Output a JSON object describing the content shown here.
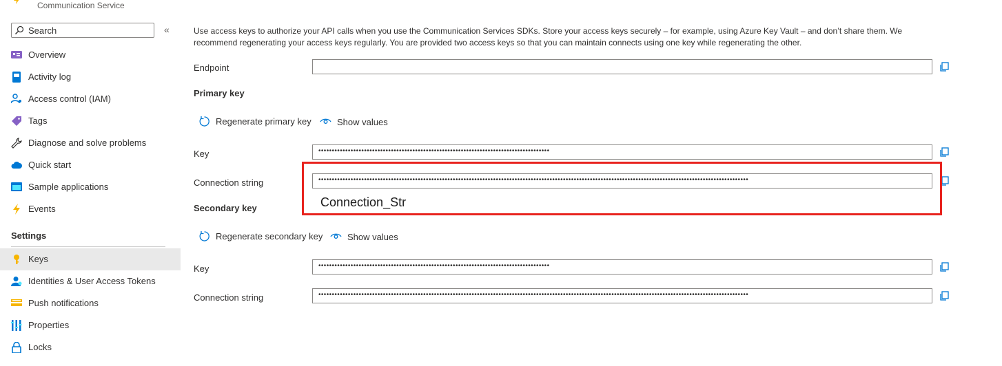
{
  "header": {
    "subtitle": "Communication Service"
  },
  "search": {
    "placeholder": "Search"
  },
  "sidebar": {
    "items": [
      {
        "label": "Overview",
        "icon": "overview-icon"
      },
      {
        "label": "Activity log",
        "icon": "activity-log-icon"
      },
      {
        "label": "Access control (IAM)",
        "icon": "iam-icon"
      },
      {
        "label": "Tags",
        "icon": "tag-icon"
      },
      {
        "label": "Diagnose and solve problems",
        "icon": "wrench-icon"
      },
      {
        "label": "Quick start",
        "icon": "cloud-icon"
      },
      {
        "label": "Sample applications",
        "icon": "sample-apps-icon"
      },
      {
        "label": "Events",
        "icon": "lightning-icon"
      }
    ],
    "settings_title": "Settings",
    "settings_items": [
      {
        "label": "Keys",
        "icon": "key-icon",
        "active": true
      },
      {
        "label": "Identities & User Access Tokens",
        "icon": "identity-icon"
      },
      {
        "label": "Push notifications",
        "icon": "push-notification-icon"
      },
      {
        "label": "Properties",
        "icon": "properties-icon"
      },
      {
        "label": "Locks",
        "icon": "lock-icon"
      }
    ]
  },
  "main": {
    "intro": "Use access keys to authorize your API calls when you use the Communication Services SDKs. Store your access keys securely – for example, using Azure Key Vault – and don’t share them. We recommend regenerating your access keys regularly. You are provided two access keys so that you can maintain connects using one key while regenerating the other.",
    "endpoint_label": "Endpoint",
    "endpoint_value": "",
    "primary": {
      "heading": "Primary key",
      "regenerate_label": "Regenerate primary key",
      "show_values_label": "Show values",
      "key_label": "Key",
      "key_value": "••••••••••••••••••••••••••••••••••••••••••••••••••••••••••••••••••••••••••••••••••••••",
      "conn_label": "Connection string",
      "conn_value": "••••••••••••••••••••••••••••••••••••••••••••••••••••••••••••••••••••••••••••••••••••••••••••••••••••••••••••••••••••••••••••••••••••••••••••••••••••••••••••••••"
    },
    "secondary": {
      "heading": "Secondary key",
      "regenerate_label": "Regenerate secondary key",
      "show_values_label": "Show values",
      "key_label": "Key",
      "key_value": "••••••••••••••••••••••••••••••••••••••••••••••••••••••••••••••••••••••••••••••••••••••",
      "conn_label": "Connection string",
      "conn_value": "••••••••••••••••••••••••••••••••••••••••••••••••••••••••••••••••••••••••••••••••••••••••••••••••••••••••••••••••••••••••••••••••••••••••••••••••••••••••••••••••"
    },
    "annotation": "Connection_Str"
  },
  "colors": {
    "accent": "#0078d4",
    "highlight": "#e8231e",
    "active_bg": "#e9e9e9"
  }
}
